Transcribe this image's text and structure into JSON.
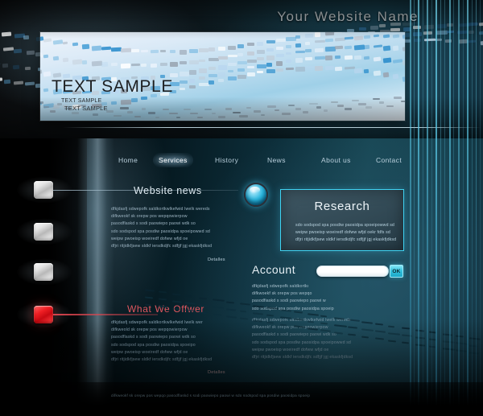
{
  "site": {
    "title": "Your Website Name",
    "banner": {
      "text_sample_large": "TEXT SAMPLE",
      "text_sample_small": "TEXT SAMPLE",
      "text_sample_tiny": "TEXT SAMPLE"
    }
  },
  "nav": {
    "items": [
      {
        "label": "Home",
        "active": false
      },
      {
        "label": "Services",
        "active": true
      },
      {
        "label": "History",
        "active": false
      },
      {
        "label": "News",
        "active": false
      },
      {
        "label": "About us",
        "active": false
      },
      {
        "label": "Contact",
        "active": false
      }
    ]
  },
  "sidebar": {
    "buttons": [
      {
        "name": "sidebar-button-1",
        "color": "silver",
        "active": false
      },
      {
        "name": "sidebar-button-2",
        "color": "silver",
        "active": false
      },
      {
        "name": "sidebar-button-3",
        "color": "silver",
        "active": false
      },
      {
        "name": "sidebar-button-4",
        "color": "red",
        "active": true
      }
    ]
  },
  "main": {
    "website_news": {
      "heading": "Website news",
      "body": "dfkjdasfj sdwepofk saldkortkwlkefwid lwelk wereds\ndifkweokf sk orepw pos  wepqowierpow\npasodflaskd s sodi paowiepo paowi wdk so\nsdo sodspod spa posdiw paosidpa spoeipowwd sd\nweipw pwoeisp woeiredf dofww wfjd oe\ndfjri ritjidkfjsew sldkf iersdkdjfc sdfjjf jgj ekaskfjdksd",
      "link": "Detalles"
    },
    "what_we_offer": {
      "heading": "What We Offwer",
      "body": "dfkjdasfj sdwepofk saldkortkwlkefwid lwelk wer\ndifkweold sk orepw pos  wepqowierpow\npasodflaskd s sodi paowiepo paowi wdk so\nsdo sodspod spa posdiw paosidpa spoeipo\nweipw pwoeisp woeiredf dofww wfjd oe\ndfjri ritjidkfjsew sldkf iersdkdjfc sdfjjf jgj ekaskfjdksd",
      "link": "Detalles"
    },
    "research": {
      "heading": "Research",
      "body": "sdo sodspod spa posdiw paosidpa spoeipowwd sd\nweipw pwoeisp woeiredf dofww wfjd oekr fdfs sd\ndfjri ritjidkfjsew sldkf iersdkdjfc sdfjjf jgj ekaskfjdksd",
      "icon": "orb-icon"
    },
    "account": {
      "heading": "Account",
      "input_value": "",
      "input_placeholder": "",
      "submit_label": "OK",
      "body": "dfkjdasfj sdwepofk saldkortkı\ndifkwoekf sk orepw pos   wepqo\npasodfiaskd s sodi paowiepo paowi w\nsdo sodspod spa posdiw paosidpa spoeip",
      "body_secondary": "dfkjdasfj sdwepofk saldkortkwlkefwid lwelk wereds\ndifkweokf sk orepw pos  wepqowierpow\npasodflaskd s sodi paowiepo paowi wdk so\nsdo sodspod spa posdiw paosidpa spoeipowwd sd\nweipw pwoeisp woeiredf dofww wfjd oe\ndfjri ritjidkfjsew sldkf iersdkdjfc sdfjjf jgj ekaskfjdksd"
    }
  },
  "footer": {
    "text": "difkweokf sk orepw pos  wepqo  pasodflaskd s sodi paowiepo paowi w    sdo sodspod spa posdiw paosidpa spoeip"
  },
  "colors": {
    "accent_cyan": "#3fd3f2",
    "accent_red": "#e0575f",
    "banner_blue": "#9fd0e8",
    "text_light": "#dfeaf1",
    "ok_button": "#36c2dd"
  }
}
